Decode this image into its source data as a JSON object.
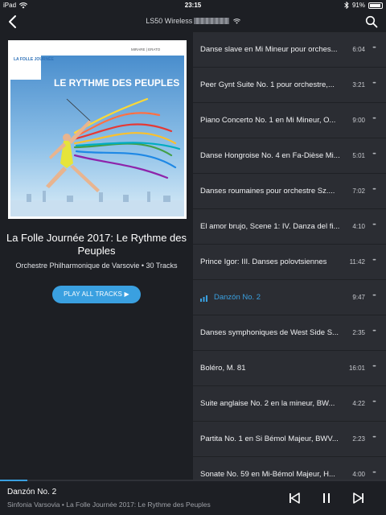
{
  "status_bar": {
    "device": "iPad",
    "time": "23:15",
    "battery": "91%"
  },
  "nav": {
    "title": "LS50 Wireless"
  },
  "album": {
    "cover_label_left": "LA FOLLE JOURNÉE",
    "cover_label_right": "MIRARE | ERATO",
    "cover_headline": "LE RYTHME DES PEUPLES",
    "title": "La Folle Journée 2017: Le Rythme des Peuples",
    "subtitle": "Orchestre Philharmonique de Varsovie • 30 Tracks",
    "play_all_label": "PLAY ALL TRACKS ▶"
  },
  "tracks": [
    {
      "title": "Danse slave en Mi Mineur pour orches...",
      "duration": "6:04"
    },
    {
      "title": "Peer Gynt Suite No. 1 pour orchestre,...",
      "duration": "3:21"
    },
    {
      "title": "Piano Concerto No. 1 en Mi Mineur, O...",
      "duration": "9:00"
    },
    {
      "title": "Danse Hongroise No. 4 en Fa-Dièse Mi...",
      "duration": "5:01"
    },
    {
      "title": "Danses roumaines pour orchestre Sz....",
      "duration": "7:02"
    },
    {
      "title": "El amor brujo, Scene 1: IV. Danza del fi...",
      "duration": "4:10"
    },
    {
      "title": "Prince Igor: III. Danses polovtsiennes",
      "duration": "11:42"
    },
    {
      "title": "Danzón No. 2",
      "duration": "9:47",
      "active": true
    },
    {
      "title": "Danses symphoniques de West Side S...",
      "duration": "2:35"
    },
    {
      "title": "Boléro, M. 81",
      "duration": "16:01"
    },
    {
      "title": "Suite anglaise No. 2 en la mineur, BW...",
      "duration": "4:22"
    },
    {
      "title": "Partita No. 1 en Si Bémol Majeur, BWV...",
      "duration": "2:23"
    },
    {
      "title": "Sonate No. 59 en Mi-Bémol Majeur, H...",
      "duration": "4:00"
    }
  ],
  "now_playing": {
    "title": "Danzón No. 2",
    "subtitle": "Sinfonia Varsovia • La Folle Journée 2017: Le Rythme des Peuples",
    "progress": 0.07
  },
  "colors": {
    "accent": "#3aa0e0",
    "background": "#1d1f24",
    "list_background": "#2b2d33"
  }
}
